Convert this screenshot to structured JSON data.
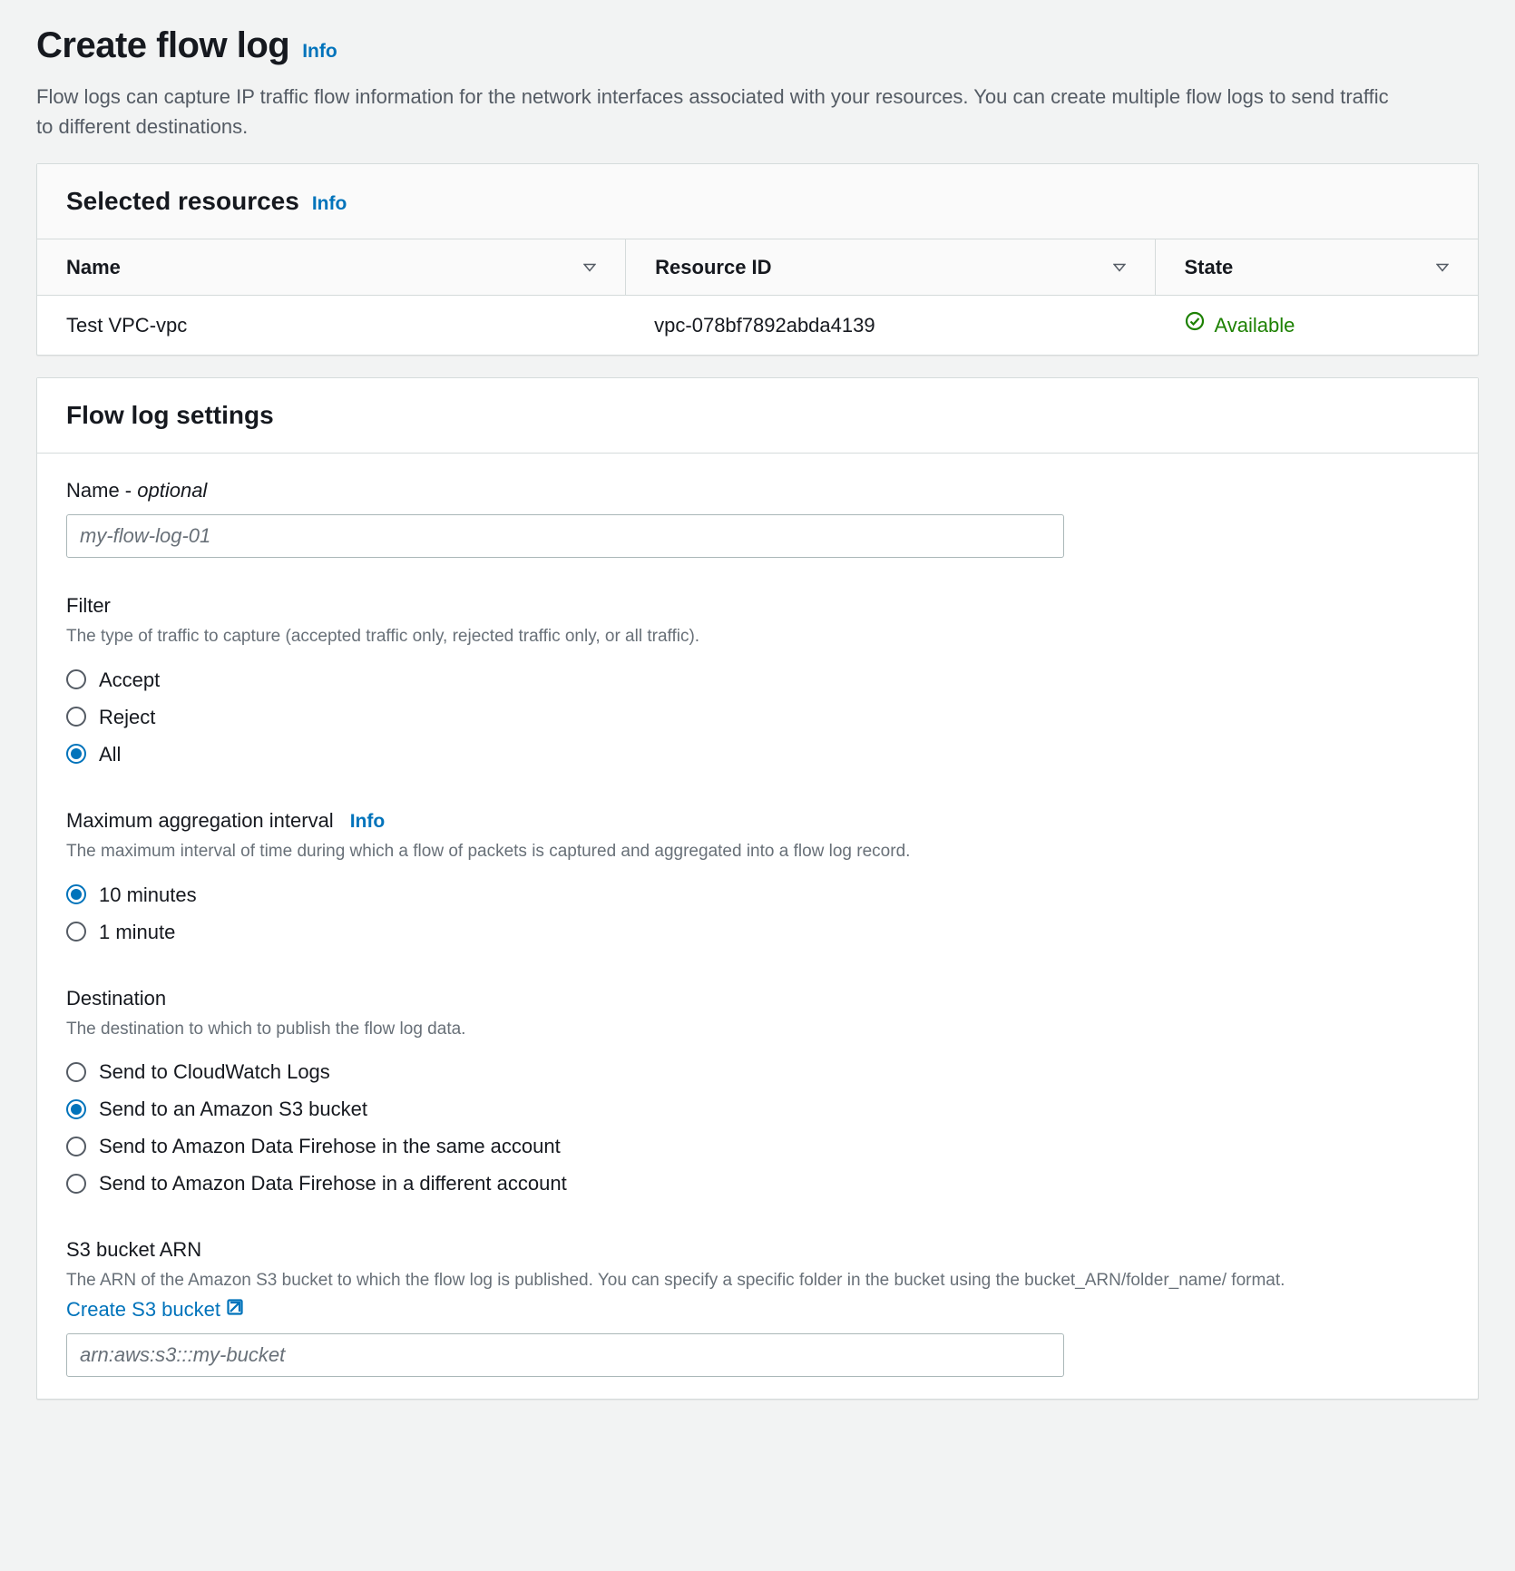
{
  "header": {
    "title": "Create flow log",
    "info": "Info",
    "description": "Flow logs can capture IP traffic flow information for the network interfaces associated with your resources. You can create multiple flow logs to send traffic to different destinations."
  },
  "selected_resources": {
    "title": "Selected resources",
    "info": "Info",
    "columns": {
      "name": "Name",
      "resource_id": "Resource ID",
      "state": "State"
    },
    "rows": [
      {
        "name": "Test VPC-vpc",
        "resource_id": "vpc-078bf7892abda4139",
        "state": "Available"
      }
    ]
  },
  "settings": {
    "title": "Flow log settings",
    "name_field": {
      "label_prefix": "Name - ",
      "label_suffix": "optional",
      "placeholder": "my-flow-log-01"
    },
    "filter": {
      "label": "Filter",
      "help": "The type of traffic to capture (accepted traffic only, rejected traffic only, or all traffic).",
      "options": {
        "accept": "Accept",
        "reject": "Reject",
        "all": "All"
      },
      "selected": "all"
    },
    "aggregation": {
      "label": "Maximum aggregation interval",
      "info": "Info",
      "help": "The maximum interval of time during which a flow of packets is captured and aggregated into a flow log record.",
      "options": {
        "ten": "10 minutes",
        "one": "1 minute"
      },
      "selected": "ten"
    },
    "destination": {
      "label": "Destination",
      "help": "The destination to which to publish the flow log data.",
      "options": {
        "cw": "Send to CloudWatch Logs",
        "s3": "Send to an Amazon S3 bucket",
        "firehose_same": "Send to Amazon Data Firehose in the same account",
        "firehose_diff": "Send to Amazon Data Firehose in a different account"
      },
      "selected": "s3"
    },
    "s3_arn": {
      "label": "S3 bucket ARN",
      "help": "The ARN of the Amazon S3 bucket to which the flow log is published. You can specify a specific folder in the bucket using the bucket_ARN/folder_name/ format. ",
      "create_link": "Create S3 bucket",
      "placeholder": "arn:aws:s3:::my-bucket"
    }
  }
}
